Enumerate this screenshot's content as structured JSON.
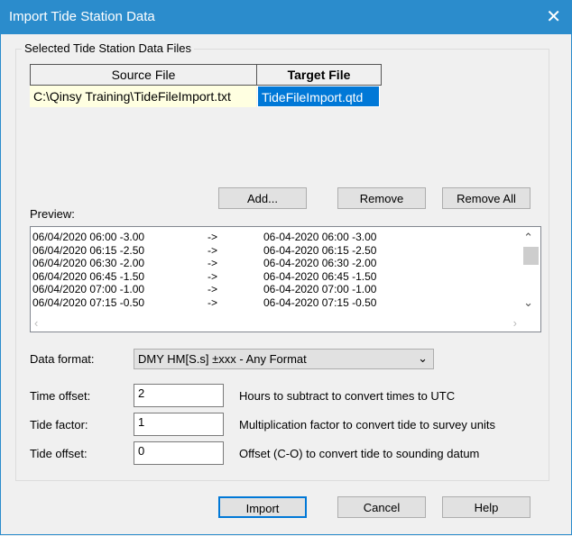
{
  "title": "Import Tide Station Data",
  "group_label": "Selected Tide Station Data Files",
  "table": {
    "headers": [
      "Source File",
      "Target File"
    ],
    "rows": [
      [
        "C:\\Qinsy Training\\TideFileImport.txt",
        "TideFileImport.qtd"
      ]
    ]
  },
  "buttons": {
    "add": "Add...",
    "remove": "Remove",
    "remove_all": "Remove All",
    "import": "Import",
    "cancel": "Cancel",
    "help": "Help"
  },
  "preview_label": "Preview:",
  "preview_rows": [
    {
      "src": "06/04/2020 06:00 -3.00",
      "arrow": "->",
      "dst": "06-04-2020 06:00 -3.00"
    },
    {
      "src": "06/04/2020 06:15 -2.50",
      "arrow": "->",
      "dst": "06-04-2020 06:15 -2.50"
    },
    {
      "src": "06/04/2020 06:30 -2.00",
      "arrow": "->",
      "dst": "06-04-2020 06:30 -2.00"
    },
    {
      "src": "06/04/2020 06:45 -1.50",
      "arrow": "->",
      "dst": "06-04-2020 06:45 -1.50"
    },
    {
      "src": "06/04/2020 07:00 -1.00",
      "arrow": "->",
      "dst": "06-04-2020 07:00 -1.00"
    },
    {
      "src": "06/04/2020 07:15 -0.50",
      "arrow": "->",
      "dst": "06-04-2020 07:15 -0.50"
    }
  ],
  "data_format": {
    "label": "Data format:",
    "value": "DMY HM[S.s] ±xxx - Any Format"
  },
  "fields": [
    {
      "label": "Time offset:",
      "value": "2",
      "desc": "Hours to subtract to convert times to UTC"
    },
    {
      "label": "Tide factor:",
      "value": "1",
      "desc": "Multiplication factor to convert tide to survey units"
    },
    {
      "label": "Tide offset:",
      "value": "0",
      "desc": "Offset (C-O) to convert tide to sounding datum"
    }
  ]
}
